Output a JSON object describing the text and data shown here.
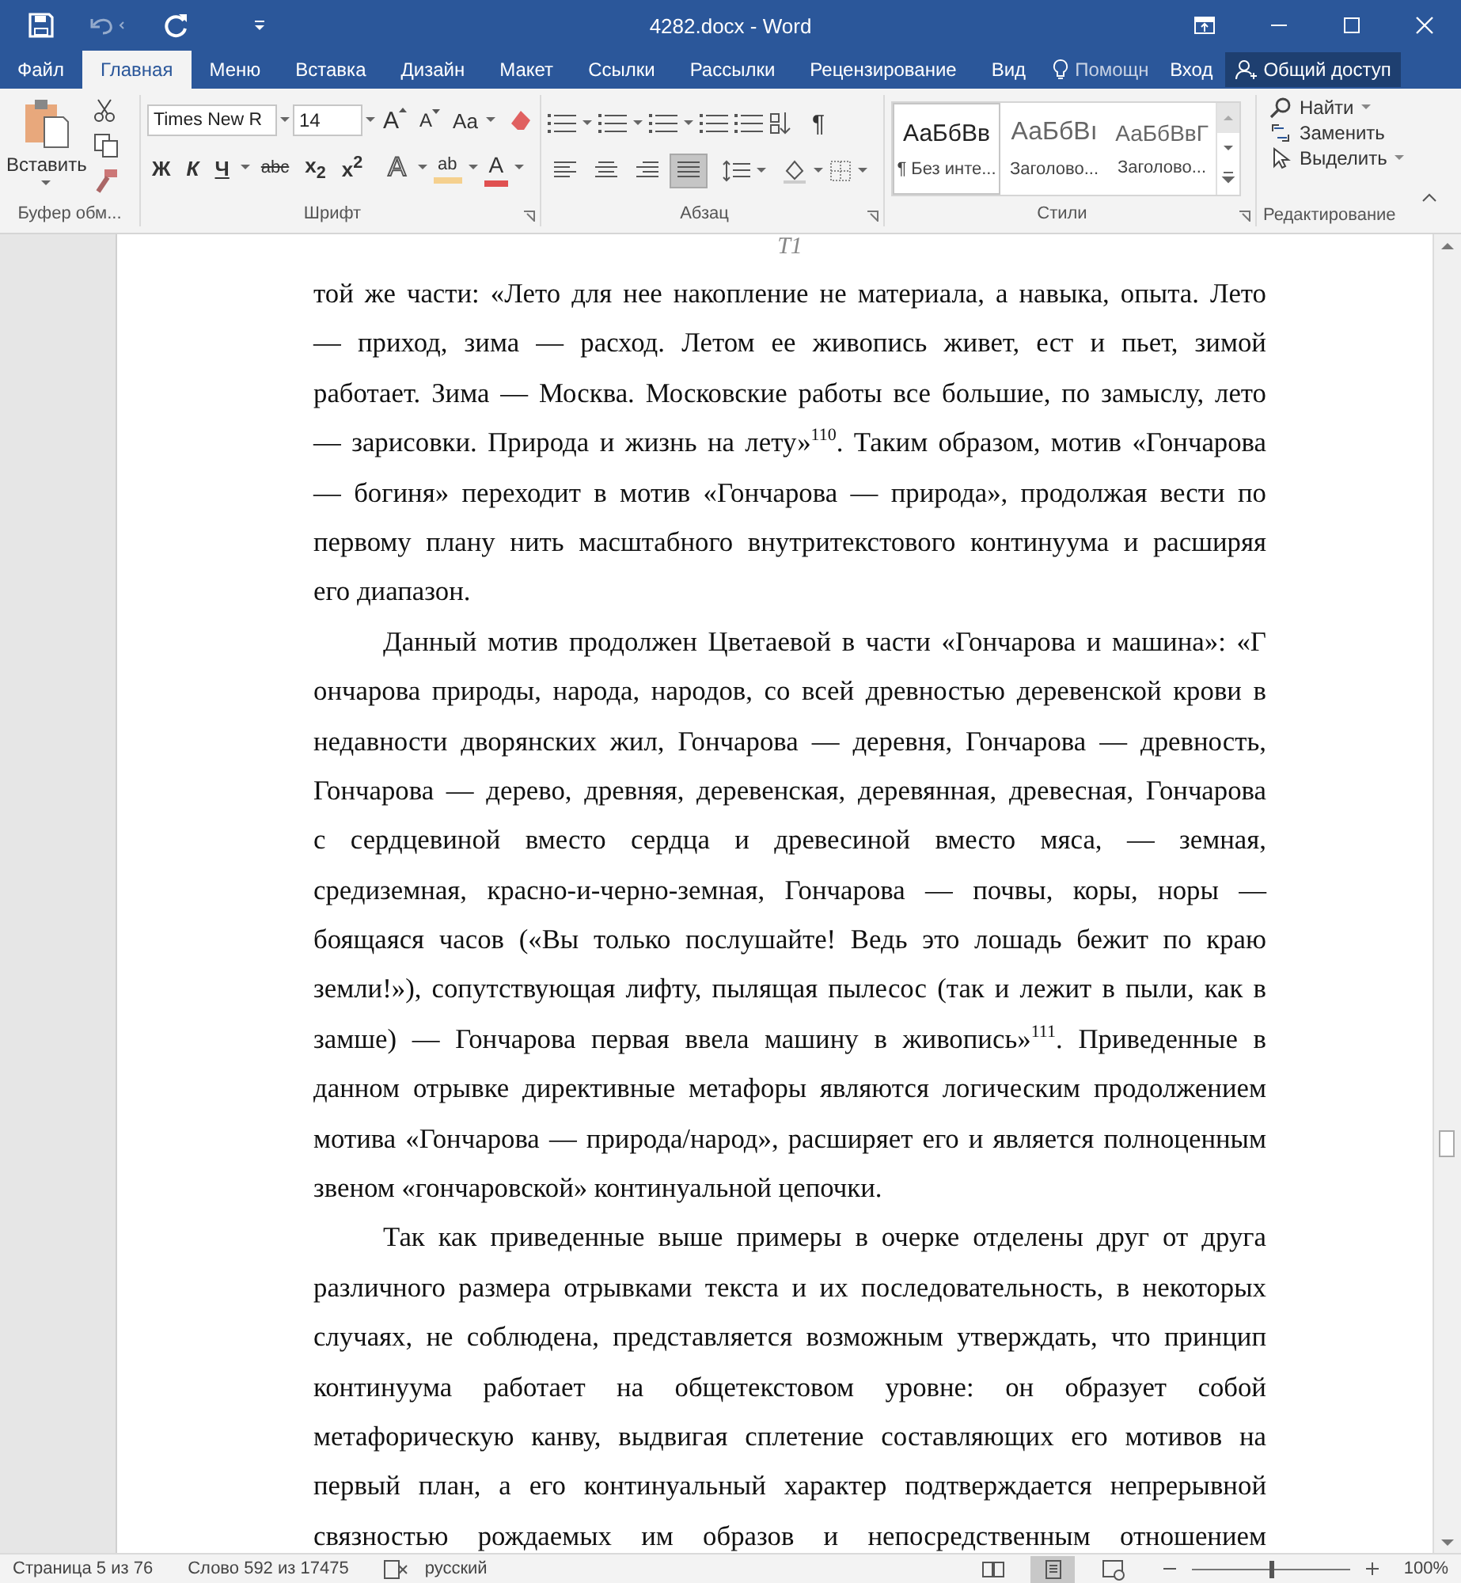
{
  "window": {
    "title": "4282.docx - Word"
  },
  "tabs": [
    {
      "label": "Файл",
      "selected": false
    },
    {
      "label": "Главная",
      "selected": true
    },
    {
      "label": "Меню",
      "selected": false
    },
    {
      "label": "Вставка",
      "selected": false
    },
    {
      "label": "Дизайн",
      "selected": false
    },
    {
      "label": "Макет",
      "selected": false
    },
    {
      "label": "Ссылки",
      "selected": false
    },
    {
      "label": "Рассылки",
      "selected": false
    },
    {
      "label": "Рецензирование",
      "selected": false
    },
    {
      "label": "Вид",
      "selected": false
    }
  ],
  "tell_me": {
    "placeholder": "Помощн"
  },
  "sign_in": "Вход",
  "share": "Общий доступ",
  "ribbon": {
    "clipboard": {
      "paste": "Вставить",
      "label": "Буфер обм..."
    },
    "font": {
      "font_name": "Times New R",
      "font_size": "14",
      "grow": "A",
      "shrink": "A",
      "change_case": "Aa",
      "bold": "Ж",
      "italic": "К",
      "underline": "Ч",
      "strikethrough": "abc",
      "subscript": "x$_{2}$",
      "superscript": "x$^{2}$",
      "text_effects": "A",
      "highlight": "ab",
      "font_color": "A",
      "label": "Шрифт"
    },
    "paragraph": {
      "alignment": [
        {
          "kind": "left",
          "selected": false
        },
        {
          "kind": "center",
          "selected": false
        },
        {
          "kind": "right",
          "selected": false
        },
        {
          "kind": "justify",
          "selected": true
        }
      ],
      "pilcrow": "¶",
      "label": "Абзац"
    },
    "styles": {
      "items": [
        {
          "sample": "АаБбВв",
          "name": "¶ Без инте...",
          "selected": true
        },
        {
          "sample": "АаБбВı",
          "name": "Заголово...",
          "selected": false
        },
        {
          "sample": "АаБбВвГ",
          "name": "Заголово...",
          "selected": false
        }
      ],
      "label": "Стили"
    },
    "editing": {
      "find": "Найти",
      "replace": "Заменить",
      "select": "Выделить",
      "label": "Редактирование"
    }
  },
  "document": {
    "header": "T1",
    "paragraphs": [
      {
        "indent": false,
        "continues": false,
        "lines": [
          "той же части: «Лето для нее накопление не материала, а навыка, опыта. Лето",
          "— приход, зима — расход. Летом ее живопись живет, ест и пьет, зимой",
          "работает. Зима — Москва. Московские работы все большие, по замыслу, лето",
          "— зарисовки. Природа и жизнь на лету»$^{110}$. Таким образом, мотив «Гончарова",
          "— богиня» переходит в мотив «Гончарова — природа», продолжая вести по",
          "первому плану нить масштабного внутритекстового континуума и расширяя",
          "его диапазон."
        ]
      },
      {
        "indent": true,
        "continues": false,
        "lines": [
          "Данный мотив продолжен Цветаевой в части «Гончарова и машина»: «Г",
          "ончарова природы, народа, народов, со всей древностью деревенской крови в",
          "недавности дворянских жил, Гончарова — деревня, Гончарова — древность,",
          "Гончарова — дерево, древняя, деревенская, деревянная, древесная, Гончарова",
          "с сердцевиной вместо сердца и древесиной вместо мяса, — земная,",
          "средиземная, красно-и-черно-земная, Гончарова — почвы, коры, норы —",
          "боящаяся часов («Вы только послушайте! Ведь это лошадь бежит по краю",
          "земли!»), сопутствующая лифту, пылящая пылесос (так и лежит в пыли, как в",
          "замше) — Гончарова первая ввела машину в живопись»$^{111}$. Приведенные в",
          "данном отрывке директивные метафоры являются логическим продолжением",
          "мотива «Гончарова — природа/народ», расширяет его и является полноценным",
          "звеном «гончаровской» континуальной цепочки."
        ]
      },
      {
        "indent": true,
        "continues": true,
        "lines": [
          "Так как приведенные выше примеры в очерке отделены друг от друга",
          "различного размера отрывками текста и их последовательность, в некоторых",
          "случаях, не соблюдена, представляется возможным утверждать, что принцип",
          "континуума работает на общетекстовом уровне: он образует собой",
          "метафорическую канву, выдвигая сплетение составляющих его мотивов на",
          "первый план, а его континуальный характер подтверждается непрерывной",
          "связностью рождаемых им образов и непосредственным отношением"
        ]
      }
    ]
  },
  "status_bar": {
    "page": "Страница 5 из 76",
    "words": "Слово 592 из 17475",
    "language": "русский",
    "views": [
      {
        "kind": "read_mode",
        "selected": false
      },
      {
        "kind": "print_layout",
        "selected": true
      },
      {
        "kind": "web_layout",
        "selected": false
      }
    ],
    "zoom": {
      "level": 0.5,
      "reading": "100%"
    }
  }
}
